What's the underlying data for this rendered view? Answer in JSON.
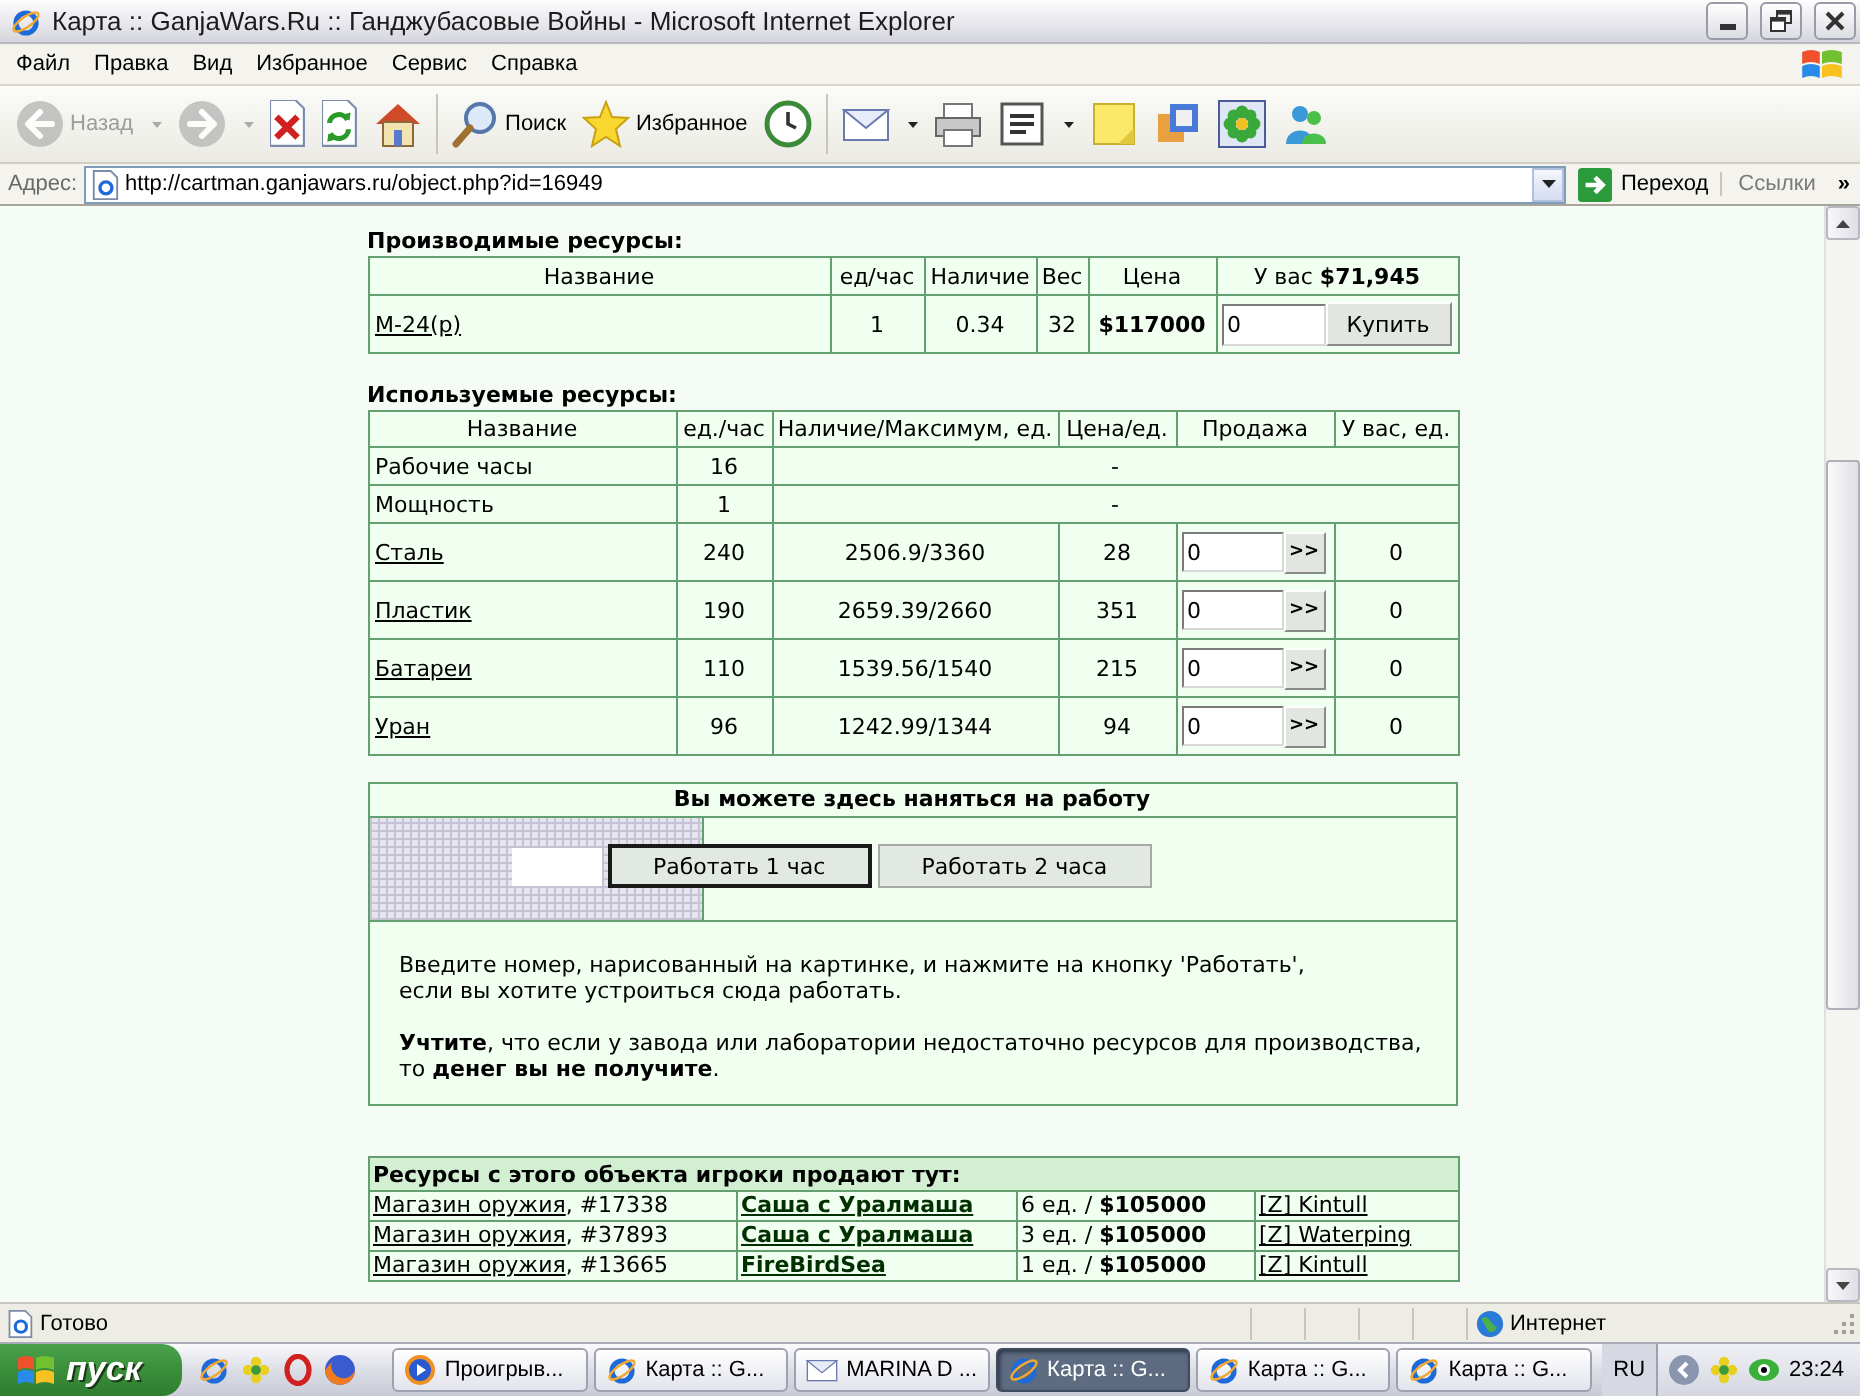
{
  "window": {
    "title": "Карта :: GanjaWars.Ru :: Ганджубасовые Войны - Microsoft Internet Explorer"
  },
  "menu": [
    "Файл",
    "Правка",
    "Вид",
    "Избранное",
    "Сервис",
    "Справка"
  ],
  "toolbar": [
    {
      "kind": "back",
      "label": "Назад",
      "disabled": true,
      "dropdown": true
    },
    {
      "kind": "forward",
      "disabled": true,
      "dropdown": true
    },
    {
      "kind": "stop",
      "disabled": false,
      "dropdown": false
    },
    {
      "kind": "refresh",
      "disabled": false,
      "dropdown": false
    },
    {
      "kind": "home",
      "disabled": false,
      "dropdown": false
    },
    {
      "kind": "search",
      "label": "Поиск",
      "disabled": false,
      "dropdown": false
    },
    {
      "kind": "favorites",
      "label": "Избранное",
      "disabled": false,
      "dropdown": false
    },
    {
      "kind": "history",
      "disabled": false,
      "dropdown": false
    },
    {
      "kind": "mail",
      "disabled": false,
      "dropdown": true
    },
    {
      "kind": "print",
      "disabled": false,
      "dropdown": false
    },
    {
      "kind": "word",
      "disabled": false,
      "dropdown": true
    },
    {
      "kind": "note",
      "disabled": false,
      "dropdown": false
    },
    {
      "kind": "paint",
      "disabled": false,
      "dropdown": false
    },
    {
      "kind": "icq",
      "disabled": false,
      "dropdown": false
    },
    {
      "kind": "messenger",
      "disabled": false,
      "dropdown": false
    }
  ],
  "address": {
    "label": "Адрес:",
    "url": "http://cartman.ganjawars.ru/object.php?id=16949",
    "go": "Переход",
    "links": "Ссылки",
    "more": "»"
  },
  "produced": {
    "title": "Производимые ресурсы:",
    "columns": [
      "Название",
      "ед/час",
      "Наличие",
      "Вес",
      "Цена",
      "У вас **$71,945**"
    ],
    "rows": [
      {
        "name": "М-24(р)",
        "per_hour": "1",
        "stock": "0.34",
        "weight": "32",
        "price": "$117000",
        "quantity": "0",
        "button": "Купить"
      }
    ]
  },
  "used": {
    "title": "Используемые ресурсы:",
    "columns": [
      "Название",
      "ед./час",
      "Наличие/Максимум, ед.",
      "Цена/ед.",
      "Продажа",
      "У вас, ед."
    ],
    "rows": [
      {
        "kind": "service",
        "name": "Рабочие часы",
        "per_hour": "16",
        "note": "-"
      },
      {
        "kind": "service",
        "name": "Мощность",
        "per_hour": "1",
        "note": "-"
      },
      {
        "kind": "resource",
        "name": "Сталь",
        "per_hour": "240",
        "stock": "2506.9/3360",
        "price": "28",
        "quantity": "0",
        "button": ">>",
        "owned": "0"
      },
      {
        "kind": "resource",
        "name": "Пластик",
        "per_hour": "190",
        "stock": "2659.39/2660",
        "price": "351",
        "quantity": "0",
        "button": ">>",
        "owned": "0"
      },
      {
        "kind": "resource",
        "name": "Батареи",
        "per_hour": "110",
        "stock": "1539.56/1540",
        "price": "215",
        "quantity": "0",
        "button": ">>",
        "owned": "0"
      },
      {
        "kind": "resource",
        "name": "Уран",
        "per_hour": "96",
        "stock": "1242.99/1344",
        "price": "94",
        "quantity": "0",
        "button": ">>",
        "owned": "0"
      }
    ]
  },
  "work": {
    "title": "Вы можете здесь наняться на работу",
    "buttons": [
      {
        "label": "Работать 1 час",
        "focused": true
      },
      {
        "label": "Работать 2 часа",
        "focused": false
      }
    ],
    "paragraphs": [
      "Введите номер, нарисованный на картинке, и нажмите на кнопку 'Работать',\nесли вы хотите устроиться сюда работать.",
      "**Учтите**, что если у завода или лаборатории недостаточно ресурсов для производства,\nто **денег вы не получите**."
    ]
  },
  "shops": {
    "title": "Ресурсы с этого объекта игроки продают тут:",
    "rows": [
      {
        "shop": "Магазин оружия",
        "number": ", #17338",
        "seller": "Саша с Уралмаша",
        "offer": "6 ед. / **$105000**",
        "owner": "[Z] Kintull"
      },
      {
        "shop": "Магазин оружия",
        "number": ", #37893",
        "seller": "Саша с Уралмаша",
        "offer": "3 ед. / **$105000**",
        "owner": "[Z] Waterping"
      },
      {
        "shop": "Магазин оружия",
        "number": ", #13665",
        "seller": "FireBirdSea",
        "offer": "1 ед. / **$105000**",
        "owner": "[Z] Kintull"
      }
    ]
  },
  "status_bar": {
    "text": "Готово",
    "zone": "Интернет"
  },
  "taskbar": {
    "start": "пуск",
    "quick_launch": [
      {
        "kind": "ie"
      },
      {
        "kind": "buddy"
      },
      {
        "kind": "opera"
      },
      {
        "kind": "firefox"
      }
    ],
    "tasks": [
      {
        "kind": "player",
        "label": "Проигрыв...",
        "selected": false
      },
      {
        "kind": "ie",
        "label": "Карта :: G...",
        "selected": false
      },
      {
        "kind": "mail",
        "label": "MARINA D ...",
        "selected": false
      },
      {
        "kind": "ie",
        "label": "Карта :: G...",
        "selected": true
      },
      {
        "kind": "ie",
        "label": "Карта :: G...",
        "selected": false
      },
      {
        "kind": "ie",
        "label": "Карта :: G...",
        "selected": false
      }
    ],
    "language": "RU",
    "tray": [
      {
        "kind": "chevron"
      },
      {
        "kind": "buddy"
      },
      {
        "kind": "eye"
      }
    ],
    "time": "23:24"
  }
}
